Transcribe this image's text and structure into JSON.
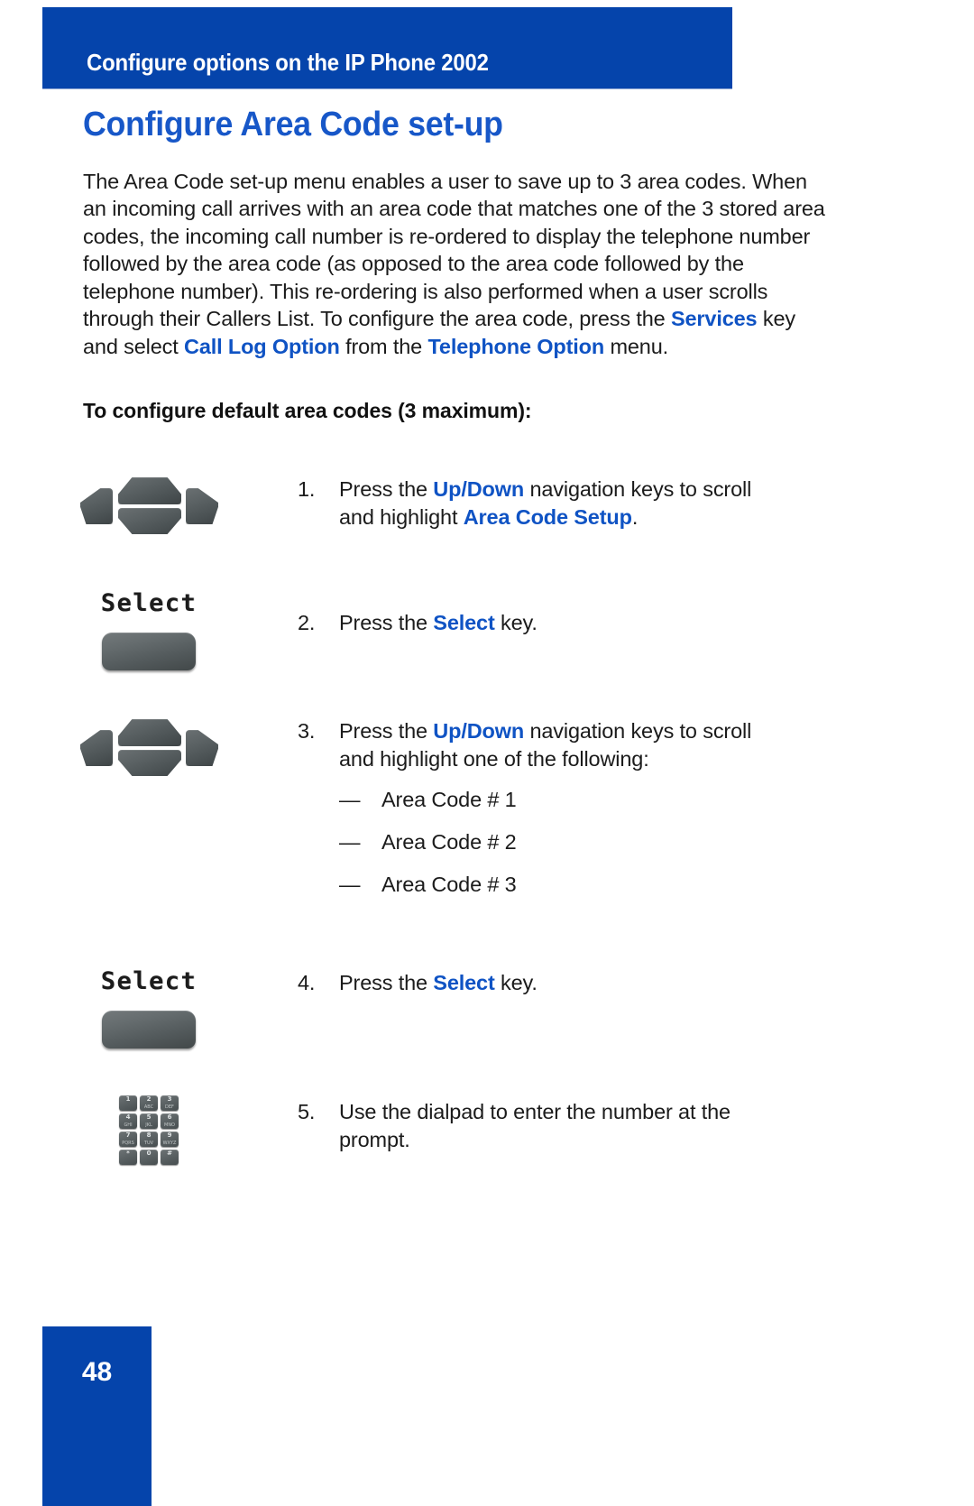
{
  "header": {
    "running_title": "Configure options on the IP Phone 2002",
    "band_color": "#0544ab"
  },
  "page": {
    "heading": "Configure Area Code set-up",
    "heading_color": "#1757c8",
    "intro": {
      "part1": "The Area Code set-up menu enables a user to save up to 3 area codes. When an incoming call arrives with an area code that matches one of the 3 stored area codes, the incoming call number is re-ordered to display the telephone number followed by the area code (as opposed to the area code followed by the telephone number). This re-ordering is also performed when a user scrolls through their Callers List. To configure the area code, press the ",
      "kw1": "Services",
      "part2": " key and select ",
      "kw2": "Call Log Option",
      "part3": " from the ",
      "kw3": "Telephone Option",
      "part4": " menu."
    },
    "sub_heading": "To configure default area codes (3 maximum):",
    "page_number": "48",
    "keyword_color": "#0f53c4"
  },
  "steps": [
    {
      "number": "1.",
      "icon": "navigation-cluster-icon",
      "line1_pre": "Press the ",
      "line1_kw": "Up/Down",
      "line1_post": " navigation keys to scroll and highlight ",
      "line2_kw": "Area Code Setup",
      "line2_post": "."
    },
    {
      "number": "2.",
      "icon": "select-softkey-icon",
      "lcd_label": "Select",
      "text_pre": "Press the ",
      "text_kw": "Select",
      "text_post": " key."
    },
    {
      "number": "3.",
      "icon": "navigation-cluster-icon",
      "line1_pre": "Press the ",
      "line1_kw": "Up/Down",
      "line1_post": " navigation keys to scroll and highlight one of the following:",
      "bullets": [
        {
          "dash": "—",
          "label": "Area Code # 1"
        },
        {
          "dash": "—",
          "label": "Area Code # 2"
        },
        {
          "dash": "—",
          "label": "Area Code # 3"
        }
      ]
    },
    {
      "number": "4.",
      "icon": "select-softkey-icon",
      "lcd_label": "Select",
      "text_pre": "Press the ",
      "text_kw": "Select",
      "text_post": " key."
    },
    {
      "number": "5.",
      "icon": "dialpad-icon",
      "text": "Use the dialpad to enter the number at the prompt."
    }
  ],
  "dialpad_keys": [
    {
      "glyph": "1",
      "sub": ""
    },
    {
      "glyph": "2",
      "sub": "ABC"
    },
    {
      "glyph": "3",
      "sub": "DEF"
    },
    {
      "glyph": "4",
      "sub": "GHI"
    },
    {
      "glyph": "5",
      "sub": "JKL"
    },
    {
      "glyph": "6",
      "sub": "MNO"
    },
    {
      "glyph": "7",
      "sub": "PQRS"
    },
    {
      "glyph": "8",
      "sub": "TUV"
    },
    {
      "glyph": "9",
      "sub": "WXYZ"
    },
    {
      "glyph": "*",
      "sub": ""
    },
    {
      "glyph": "0",
      "sub": ""
    },
    {
      "glyph": "#",
      "sub": ""
    }
  ]
}
